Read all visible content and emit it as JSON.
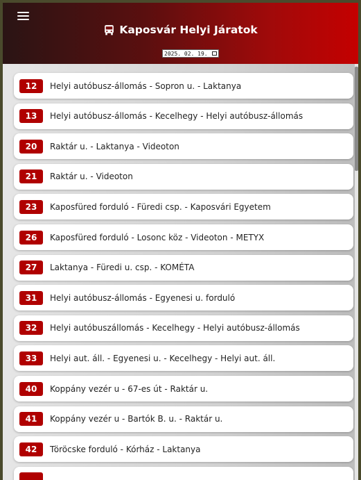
{
  "header": {
    "title": "Kaposvár Helyi Járatok",
    "date": "2025. 02. 19."
  },
  "colors": {
    "accent": "#b00000",
    "header_start": "#2a1414",
    "header_end": "#c40000"
  },
  "icons": [
    "menu-icon",
    "bus-icon",
    "calendar-icon"
  ],
  "routes": [
    {
      "number": "12",
      "name": "Helyi autóbusz-állomás - Sopron u. - Laktanya"
    },
    {
      "number": "13",
      "name": "Helyi autóbusz-állomás - Kecelhegy - Helyi autóbusz-állomás"
    },
    {
      "number": "20",
      "name": "Raktár u. - Laktanya - Videoton"
    },
    {
      "number": "21",
      "name": "Raktár u. - Videoton"
    },
    {
      "number": "23",
      "name": "Kaposfüred forduló - Füredi csp. - Kaposvári Egyetem"
    },
    {
      "number": "26",
      "name": "Kaposfüred forduló - Losonc köz - Videoton - METYX"
    },
    {
      "number": "27",
      "name": "Laktanya - Füredi u. csp. - KOMÉTA"
    },
    {
      "number": "31",
      "name": "Helyi autóbusz-állomás - Egyenesi u. forduló"
    },
    {
      "number": "32",
      "name": "Helyi autóbuszállomás - Kecelhegy - Helyi autóbusz-állomás"
    },
    {
      "number": "33",
      "name": "Helyi aut. áll. - Egyenesi u. - Kecelhegy - Helyi aut. áll."
    },
    {
      "number": "40",
      "name": "Koppány vezér u - 67-es út - Raktár u."
    },
    {
      "number": "41",
      "name": "Koppány vezér u - Bartók B. u. - Raktár u."
    },
    {
      "number": "42",
      "name": "Töröcske forduló - Kórház - Laktanya"
    },
    {
      "number": "",
      "name": ""
    }
  ]
}
